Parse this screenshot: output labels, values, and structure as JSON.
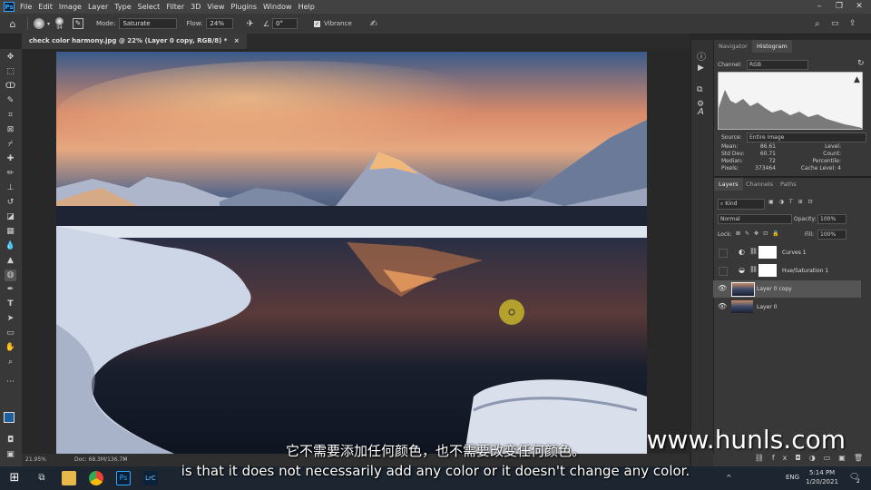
{
  "menubar": {
    "app_icon": "Ps",
    "items": [
      "File",
      "Edit",
      "Image",
      "Layer",
      "Type",
      "Select",
      "Filter",
      "3D",
      "View",
      "Plugins",
      "Window",
      "Help"
    ]
  },
  "options": {
    "brush_size": "94",
    "mode_label": "Mode:",
    "mode_value": "Saturate",
    "flow_label": "Flow:",
    "flow_value": "24%",
    "angle_value": "0°",
    "vibrance_label": "Vibrance"
  },
  "document_tab": {
    "title": "check color harmony.jpg @ 22% (Layer 0 copy, RGB/8) *"
  },
  "status": {
    "zoom": "21.95%",
    "doc": "Doc: 68.3M/136.7M"
  },
  "histogram_panel": {
    "tabs": [
      "Navigator",
      "Histogram"
    ],
    "channel_label": "Channel:",
    "channel_value": "RGB",
    "source_label": "Source:",
    "source_value": "Entire Image",
    "stats_left": [
      {
        "label": "Mean:",
        "value": "86.61"
      },
      {
        "label": "Std Dev:",
        "value": "60.71"
      },
      {
        "label": "Median:",
        "value": "72"
      },
      {
        "label": "Pixels:",
        "value": "373464"
      }
    ],
    "stats_right": [
      {
        "label": "Level:",
        "value": ""
      },
      {
        "label": "Count:",
        "value": ""
      },
      {
        "label": "Percentile:",
        "value": ""
      },
      {
        "label": "Cache Level:",
        "value": "4"
      }
    ]
  },
  "layers_panel": {
    "tabs": [
      "Layers",
      "Channels",
      "Paths"
    ],
    "kind_label": "Kind",
    "blend_mode": "Normal",
    "opacity_label": "Opacity:",
    "opacity_value": "100%",
    "lock_label": "Lock:",
    "fill_label": "Fill:",
    "fill_value": "100%",
    "layers": [
      {
        "name": "Curves 1",
        "visible": false,
        "selected": false
      },
      {
        "name": "Hue/Saturation 1",
        "visible": false,
        "selected": false
      },
      {
        "name": "Layer 0 copy",
        "visible": true,
        "selected": true
      },
      {
        "name": "Layer 0",
        "visible": true,
        "selected": false
      }
    ]
  },
  "subtitles": {
    "chinese": "它不需要添加任何颜色，也不需要改变任何颜色。",
    "english": "is that it does not necessarily add any color or it doesn't change any color."
  },
  "watermark": "www.hunls.com",
  "taskbar": {
    "lang": "ENG",
    "time": "5:14 PM",
    "date": "1/20/2021",
    "notification_count": "2"
  },
  "colors": {
    "accent": "#31a8ff",
    "panel_bg": "#383838",
    "canvas_bg": "#282828"
  }
}
